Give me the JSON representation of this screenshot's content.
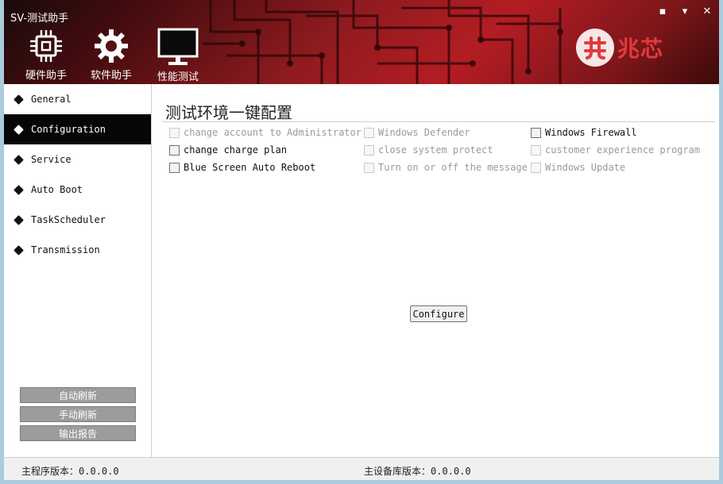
{
  "window": {
    "title": "SV-测试助手",
    "controls": [
      "▪",
      "▾",
      "✕"
    ]
  },
  "toolbar": {
    "tabs": [
      {
        "label": "硬件助手",
        "icon": "cpu-chip-icon"
      },
      {
        "label": "软件助手",
        "icon": "gear-icon"
      },
      {
        "label": "性能测试",
        "icon": "monitor-icon"
      }
    ]
  },
  "brand": {
    "name": "兆芯",
    "accent": "#e03a3f"
  },
  "sidebar": {
    "items": [
      {
        "label": "General"
      },
      {
        "label": "Configuration"
      },
      {
        "label": "Service"
      },
      {
        "label": "Auto Boot"
      },
      {
        "label": "TaskScheduler"
      },
      {
        "label": "Transmission"
      }
    ],
    "active_item": "Configuration",
    "buttons": [
      "自动刷新",
      "手动刷新",
      "输出报告"
    ]
  },
  "main": {
    "title": "测试环境一键配置",
    "options": [
      {
        "label": "change account to Administrator",
        "enabled": false,
        "checked": false
      },
      {
        "label": "Windows Defender",
        "enabled": false,
        "checked": false
      },
      {
        "label": "Windows Firewall",
        "enabled": true,
        "checked": false
      },
      {
        "label": "change charge plan",
        "enabled": true,
        "checked": false
      },
      {
        "label": "close system protect",
        "enabled": false,
        "checked": false
      },
      {
        "label": "customer experience program",
        "enabled": false,
        "checked": false
      },
      {
        "label": "Blue Screen Auto Reboot",
        "enabled": true,
        "checked": false
      },
      {
        "label": "Turn on or off the message",
        "enabled": false,
        "checked": false
      },
      {
        "label": "Windows Update",
        "enabled": false,
        "checked": false
      }
    ],
    "configure_button": "Configure"
  },
  "status": {
    "main_version_label": "主程序版本：",
    "main_version": "0.0.0.0",
    "db_version_label": "主设备库版本：",
    "db_version": "0.0.0.0"
  }
}
